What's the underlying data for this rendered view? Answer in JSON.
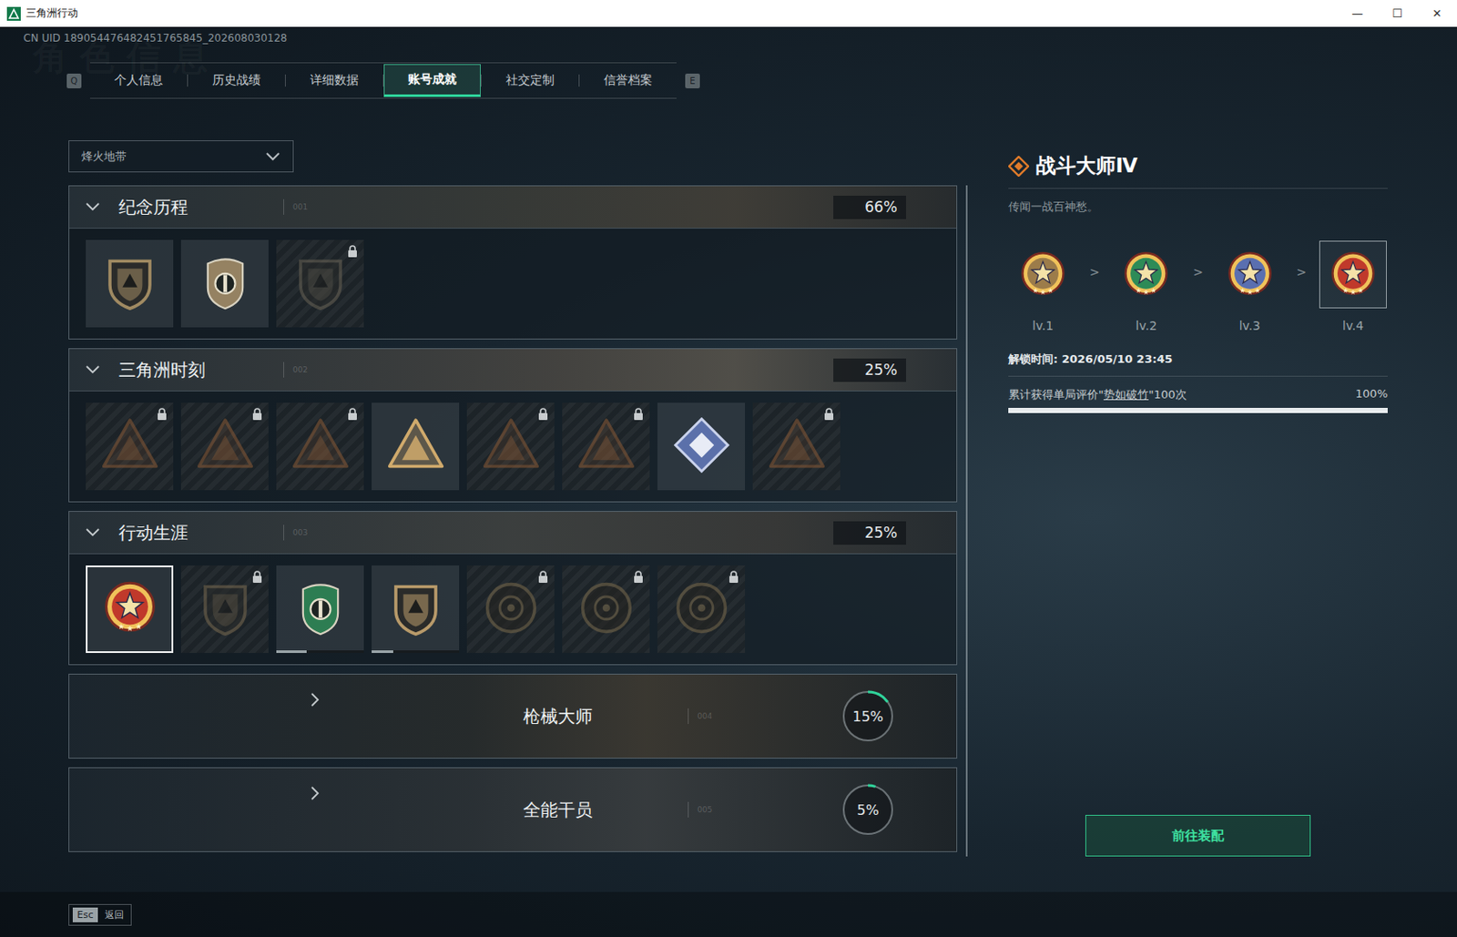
{
  "window": {
    "title": "三角洲行动",
    "controls": [
      "—",
      "☐",
      "✕"
    ]
  },
  "uid": "CN UID 189054476482451765845_202608030128",
  "watermark": "角色信息",
  "tabs": {
    "prev_key": "Q",
    "next_key": "E",
    "items": [
      {
        "label": "个人信息",
        "selected": false
      },
      {
        "label": "历史战绩",
        "selected": false
      },
      {
        "label": "详细数据",
        "selected": false
      },
      {
        "label": "账号成就",
        "selected": true
      },
      {
        "label": "社交定制",
        "selected": false
      },
      {
        "label": "信誉档案",
        "selected": false
      }
    ]
  },
  "mode_dropdown": {
    "value": "烽火地带"
  },
  "sections": [
    {
      "title": "纪念历程",
      "code": "001",
      "expanded": true,
      "percent": "66%",
      "badges": [
        {
          "kind": "shield",
          "color": "#a08a62",
          "locked": false,
          "selected": false
        },
        {
          "kind": "crest",
          "color": "#a8906a",
          "locked": false,
          "selected": false
        },
        {
          "kind": "shield",
          "color": "#6a6456",
          "locked": true,
          "selected": false
        }
      ]
    },
    {
      "title": "三角洲时刻",
      "code": "002",
      "expanded": true,
      "percent": "25%",
      "badges": [
        {
          "kind": "triangle",
          "color": "#8a5a36",
          "locked": true,
          "selected": false
        },
        {
          "kind": "triangle",
          "color": "#8a5a36",
          "locked": true,
          "selected": false
        },
        {
          "kind": "triangle",
          "color": "#8a5a36",
          "locked": true,
          "selected": false
        },
        {
          "kind": "triangle",
          "color": "#d0aa6c",
          "locked": false,
          "selected": false
        },
        {
          "kind": "triangle",
          "color": "#8a5a36",
          "locked": true,
          "selected": false
        },
        {
          "kind": "triangle",
          "color": "#8a5a36",
          "locked": true,
          "selected": false
        },
        {
          "kind": "diamond",
          "color": "#5b70aa",
          "locked": false,
          "selected": false
        },
        {
          "kind": "triangle",
          "color": "#8a5a36",
          "locked": true,
          "selected": false
        }
      ]
    },
    {
      "title": "行动生涯",
      "code": "003",
      "expanded": true,
      "percent": "25%",
      "badges": [
        {
          "kind": "star",
          "color": "#c0392b",
          "locked": false,
          "selected": true
        },
        {
          "kind": "shield",
          "color": "#7a6a50",
          "locked": true,
          "selected": false
        },
        {
          "kind": "crest",
          "color": "#2e8b57",
          "locked": false,
          "selected": false,
          "level": 0.35
        },
        {
          "kind": "shield",
          "color": "#b89a6a",
          "locked": false,
          "selected": false,
          "level": 0.25
        },
        {
          "kind": "circle",
          "color": "#7a6a4c",
          "locked": true,
          "selected": false
        },
        {
          "kind": "circle",
          "color": "#7a6a4c",
          "locked": true,
          "selected": false
        },
        {
          "kind": "circle",
          "color": "#7a6a4c",
          "locked": true,
          "selected": false
        }
      ]
    },
    {
      "title": "枪械大师",
      "code": "004",
      "expanded": false,
      "percent": "15%",
      "level": 0.15
    },
    {
      "title": "全能干员",
      "code": "005",
      "expanded": false,
      "percent": "5%",
      "level": 0.05
    }
  ],
  "detail": {
    "title": "战斗大师Ⅳ",
    "description": "传闻一战百神愁。",
    "separator": ">",
    "levels": [
      {
        "label": "lv.1",
        "color": "#9c7c4a",
        "selected": false
      },
      {
        "label": "lv.2",
        "color": "#2e8b57",
        "selected": false
      },
      {
        "label": "lv.3",
        "color": "#5a6fb0",
        "selected": false
      },
      {
        "label": "lv.4",
        "color": "#c0392b",
        "selected": true
      }
    ],
    "unlock_time": "解锁时间: 2026/05/10 23:45",
    "requirement": {
      "prefix": "累计获得单局评价\"",
      "highlight": "势如破竹",
      "suffix": "\"100次",
      "percent": "100%",
      "level": 1
    },
    "button": "前往装配"
  },
  "footer": {
    "key": "Esc",
    "label": "返回"
  }
}
